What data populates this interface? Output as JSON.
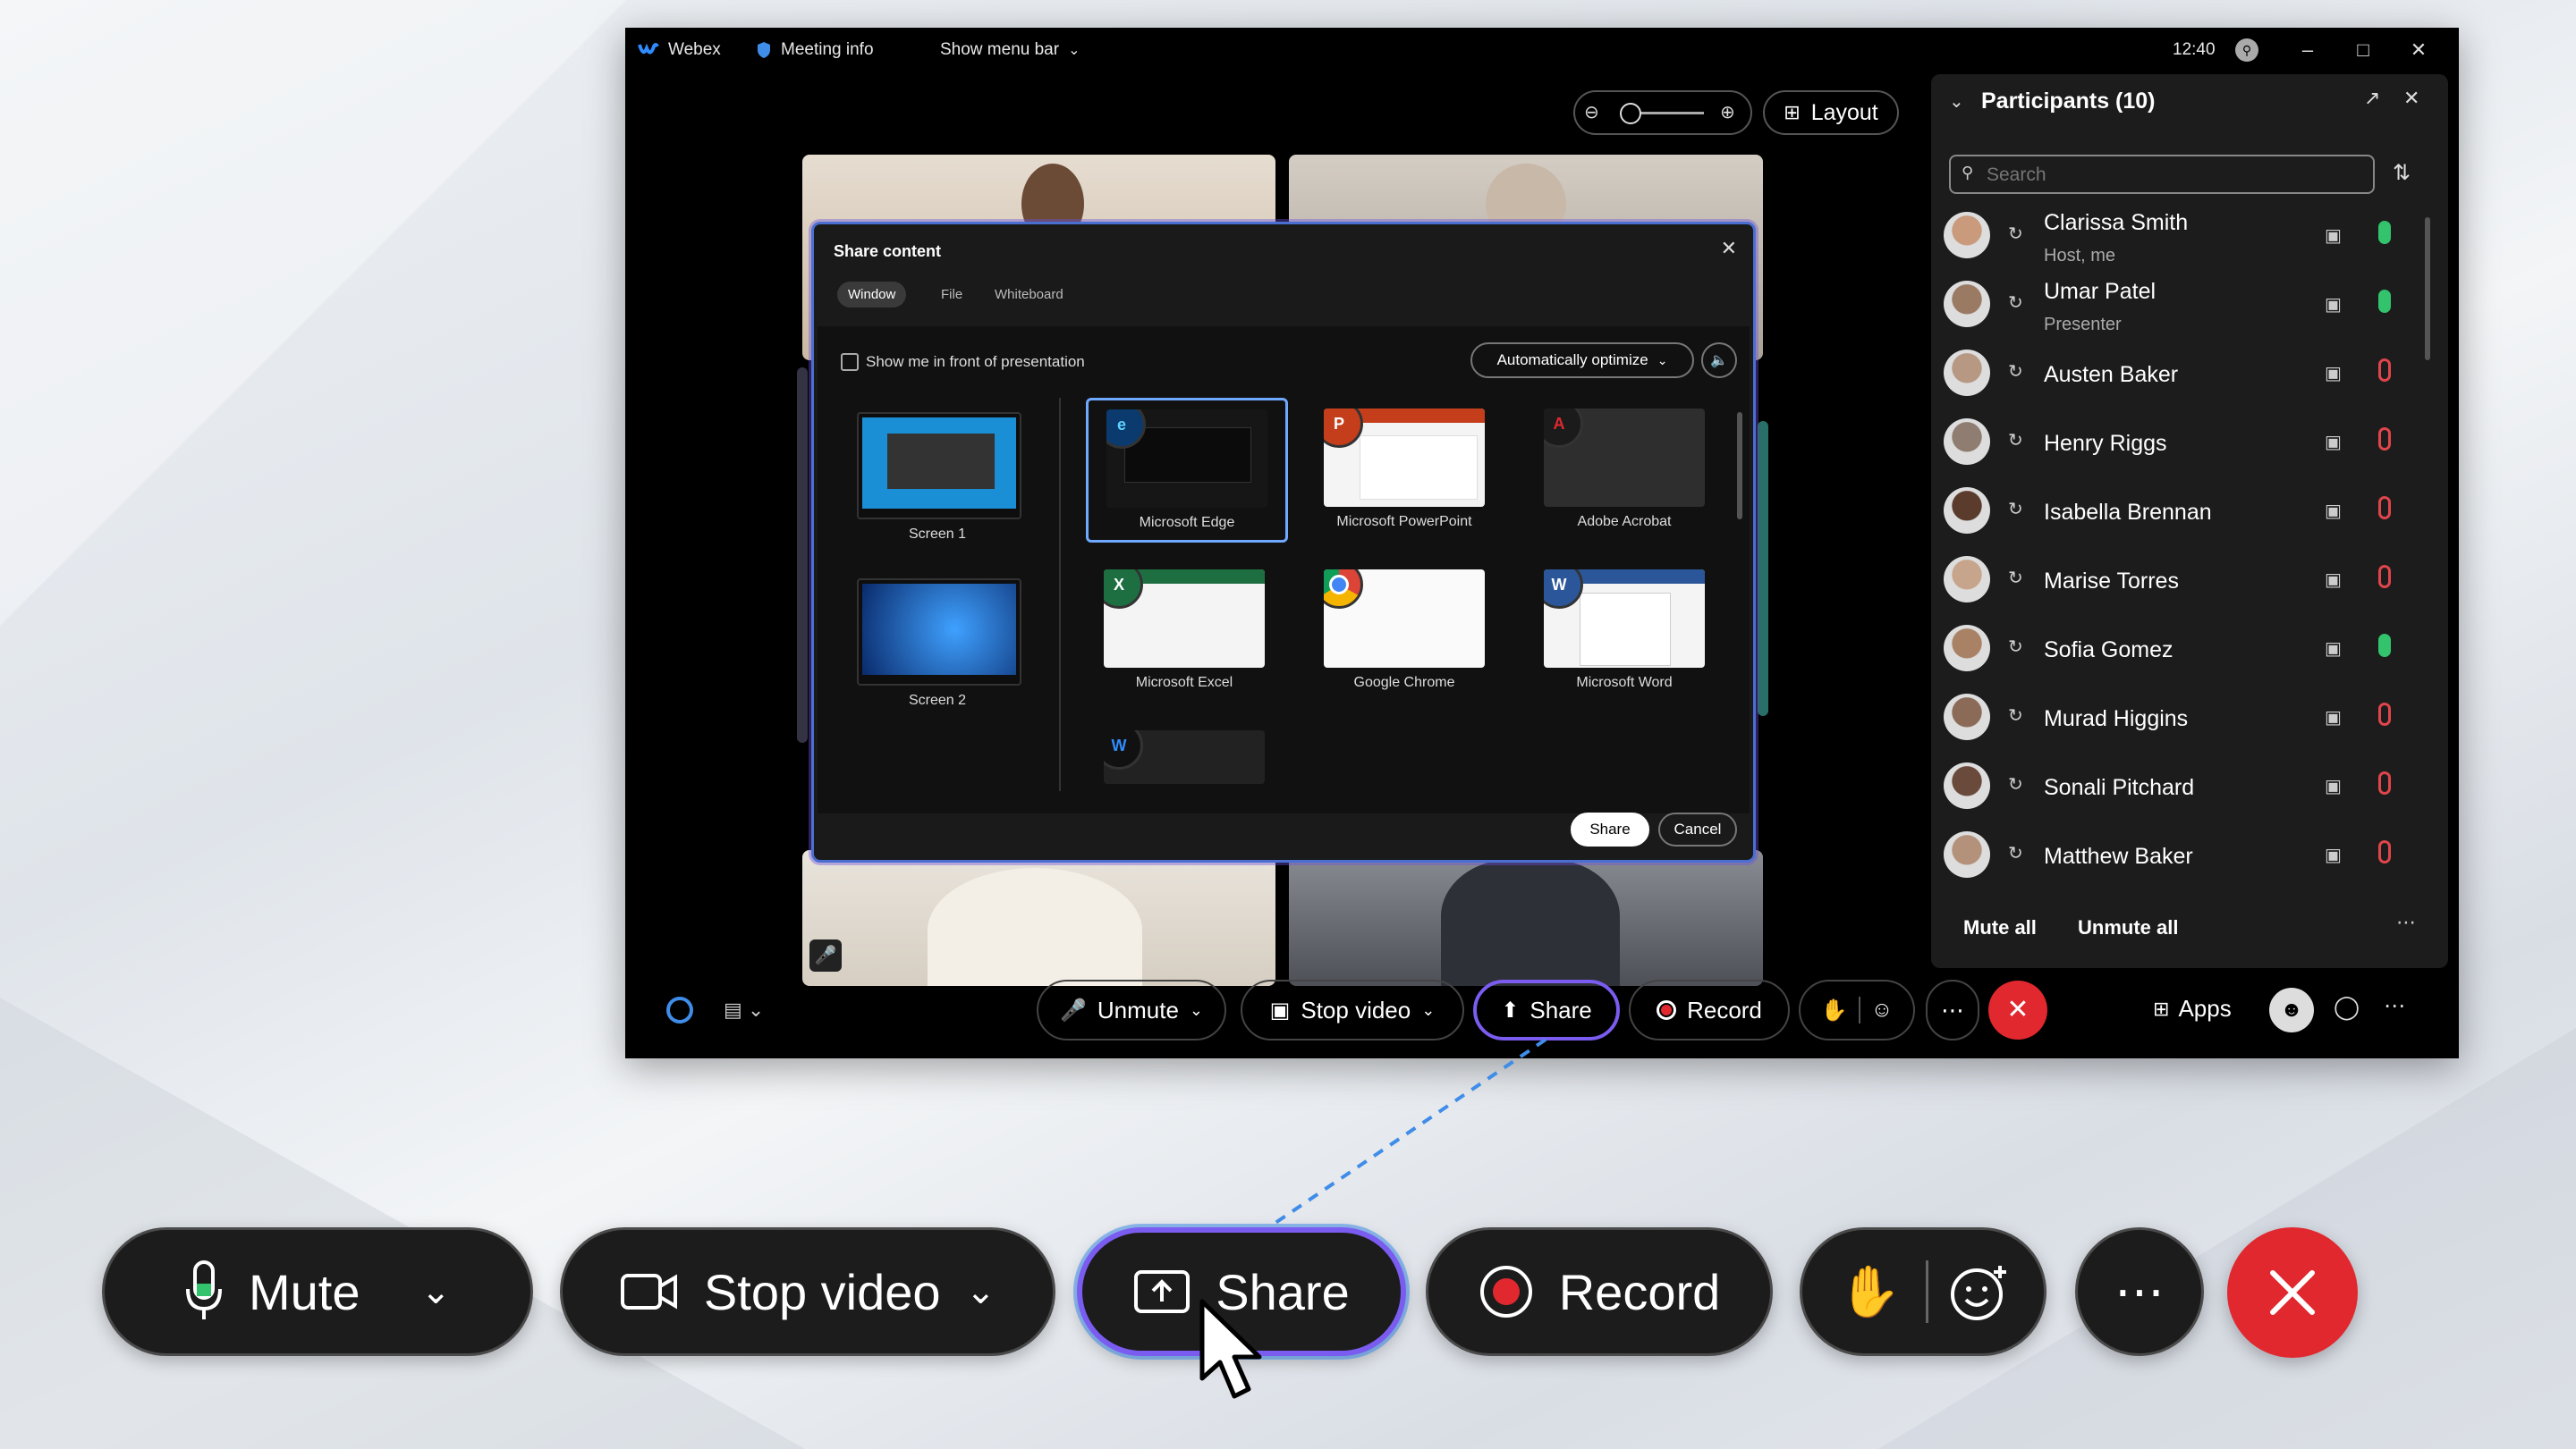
{
  "window": {
    "app_name": "Webex",
    "meeting_info": "Meeting info",
    "show_menu_bar": "Show menu bar",
    "clock": "12:40",
    "layout_label": "Layout"
  },
  "share_dialog": {
    "title": "Share content",
    "tabs": [
      "Window",
      "File",
      "Whiteboard"
    ],
    "show_me_label": "Show me in front of presentation",
    "optimize_label": "Automatically optimize",
    "screens": [
      "Screen 1",
      "Screen 2"
    ],
    "apps": [
      {
        "name": "Microsoft Edge",
        "icon": "edge-icon"
      },
      {
        "name": "Microsoft PowerPoint",
        "icon": "powerpoint-icon"
      },
      {
        "name": "Adobe Acrobat",
        "icon": "acrobat-icon"
      },
      {
        "name": "Microsoft Excel",
        "icon": "excel-icon"
      },
      {
        "name": "Google Chrome",
        "icon": "chrome-icon"
      },
      {
        "name": "Microsoft Word",
        "icon": "word-icon"
      }
    ],
    "share_label": "Share",
    "cancel_label": "Cancel"
  },
  "participants": {
    "title": "Participants (10)",
    "search_placeholder": "Search",
    "list": [
      {
        "name": "Clarissa Smith",
        "role": "Host, me",
        "mic": "on"
      },
      {
        "name": "Umar Patel",
        "role": "Presenter",
        "mic": "on"
      },
      {
        "name": "Austen Baker",
        "role": "",
        "mic": "muted"
      },
      {
        "name": "Henry Riggs",
        "role": "",
        "mic": "muted"
      },
      {
        "name": "Isabella Brennan",
        "role": "",
        "mic": "muted"
      },
      {
        "name": "Marise Torres",
        "role": "",
        "mic": "muted"
      },
      {
        "name": "Sofia Gomez",
        "role": "",
        "mic": "on"
      },
      {
        "name": "Murad Higgins",
        "role": "",
        "mic": "muted"
      },
      {
        "name": "Sonali Pitchard",
        "role": "",
        "mic": "muted"
      },
      {
        "name": "Matthew Baker",
        "role": "",
        "mic": "muted"
      }
    ],
    "mute_all": "Mute all",
    "unmute_all": "Unmute all"
  },
  "window_toolbar": {
    "unmute": "Unmute",
    "stop_video": "Stop video",
    "share": "Share",
    "record": "Record",
    "apps": "Apps"
  },
  "big_toolbar": {
    "mute": "Mute",
    "stop_video": "Stop video",
    "share": "Share",
    "record": "Record"
  },
  "colors": {
    "accent_purple": "#7b5cf0",
    "accent_blue": "#3f8de8",
    "end_red": "#e0282e",
    "mic_green": "#32c36c",
    "mic_muted_red": "#e0454b"
  }
}
